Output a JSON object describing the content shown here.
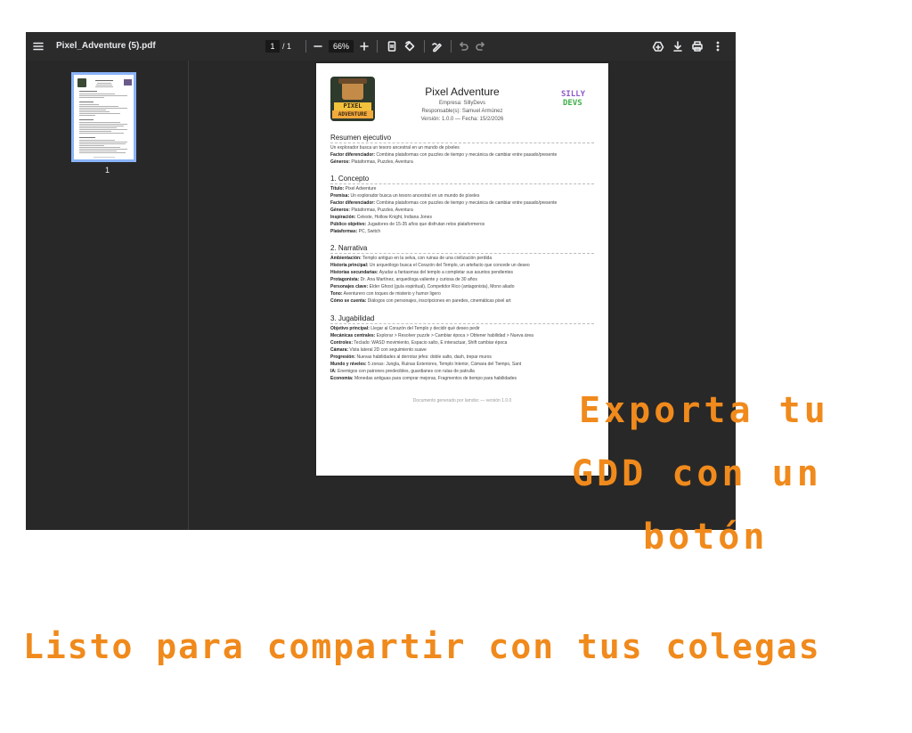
{
  "viewer": {
    "filename": "Pixel_Adventure (5).pdf",
    "page_current": "1",
    "page_total": "/ 1",
    "zoom": "66%",
    "thumbnail_page_number": "1"
  },
  "document": {
    "title": "Pixel Adventure",
    "company": "Empresa: SillyDevs",
    "responsible": "Responsable(s): Samuel Armúnez",
    "version": "Versión: 1.0.0 — Fecha: 15/2/2026",
    "logo_text_1": "PIXEL",
    "logo_text_2": "ADVENTURE",
    "brand_line_1": "SILLY",
    "brand_line_2": "DEVS",
    "sections": [
      {
        "heading": "Resumen ejecutivo",
        "lines": [
          {
            "label": "",
            "value": "Un explorador busca un tesoro ancestral en un mundo de píxeles"
          },
          {
            "label": "Factor diferenciador:",
            "value": " Combina plataformas con puzzles de tiempo y mecánica de cambiar entre pasado/presente"
          },
          {
            "label": "Géneros:",
            "value": " Plataformas, Puzzles, Aventura"
          }
        ]
      },
      {
        "heading": "1. Concepto",
        "lines": [
          {
            "label": "Título:",
            "value": " Pixel Adventure"
          },
          {
            "label": "Premisa:",
            "value": " Un explorador busca un tesoro ancestral en un mundo de píxeles"
          },
          {
            "label": "Factor diferenciador:",
            "value": " Combina plataformas con puzzles de tiempo y mecánica de cambiar entre pasado/presente"
          },
          {
            "label": "Géneros:",
            "value": " Plataformas, Puzzles, Aventura"
          },
          {
            "label": "Inspiración:",
            "value": " Celeste, Hollow Knight, Indiana Jones"
          },
          {
            "label": "Público objetivo:",
            "value": " Jugadores de 15-35 años que disfrutan retos plataformeros"
          },
          {
            "label": "Plataformas:",
            "value": " PC, Switch"
          }
        ]
      },
      {
        "heading": "2. Narrativa",
        "lines": [
          {
            "label": "Ambientación:",
            "value": " Templo antiguo en la selva, con ruinas de una civilización perdida"
          },
          {
            "label": "Historia principal:",
            "value": " Un arqueólogo busca el Corazón del Templo, un artefacto que concede un deseo"
          },
          {
            "label": "Historias secundarias:",
            "value": " Ayudar a fantasmas del templo a completar sus asuntos pendientes"
          },
          {
            "label": "Protagonista:",
            "value": " Dr. Ana Martínez, arqueóloga valiente y curiosa de 30 años"
          },
          {
            "label": "Personajes clave:",
            "value": " Elder Ghost (guía espiritual), Competidor Rico (antagonista), Mono aliado"
          },
          {
            "label": "Tono:",
            "value": " Aventurero con toques de misterio y humor ligero"
          },
          {
            "label": "Cómo se cuenta:",
            "value": " Diálogos con personajes, inscripciones en paredes, cinemáticas pixel art"
          }
        ]
      },
      {
        "heading": "3. Jugabilidad",
        "lines": [
          {
            "label": "Objetivo principal:",
            "value": " Llegar al Corazón del Templo y decidir qué deseo pedir"
          },
          {
            "label": "Mecánicas centrales:",
            "value": " Explorar > Resolver puzzle > Cambiar época > Obtener habilidad > Nueva área"
          },
          {
            "label": "Controles:",
            "value": " Teclado: WASD movimiento, Espacio salto, E interactuar, Shift cambiar época"
          },
          {
            "label": "Cámara:",
            "value": " Vista lateral 2D con seguimiento suave"
          },
          {
            "label": "Progresión:",
            "value": " Nuevas habilidades al derrotar jefes: doble salto, dash, trepar muros"
          },
          {
            "label": "Mundo y niveles:",
            "value": " 5 zonas: Jungla, Ruinas Exteriores, Templo Interior, Cámara del Tiempo, Sant"
          },
          {
            "label": "IA:",
            "value": " Enemigos con patrones predecibles, guardianes con rutas de patrulla"
          },
          {
            "label": "Economía:",
            "value": " Monedas antiguas para comprar mejoras, Fragmentos de tiempo para habilidades"
          }
        ]
      }
    ],
    "footer": "Documento generado por lamdoc — versión 1.0.0"
  },
  "promo": {
    "line1": "Exporta tu",
    "line2": "GDD con un",
    "line3": "botón",
    "tagline": "Listo para compartir con tus colegas"
  },
  "colors": {
    "promo_orange": "#f08a1c",
    "toolbar": "#2b2b2b",
    "thumb_border": "#8ab4f8"
  }
}
